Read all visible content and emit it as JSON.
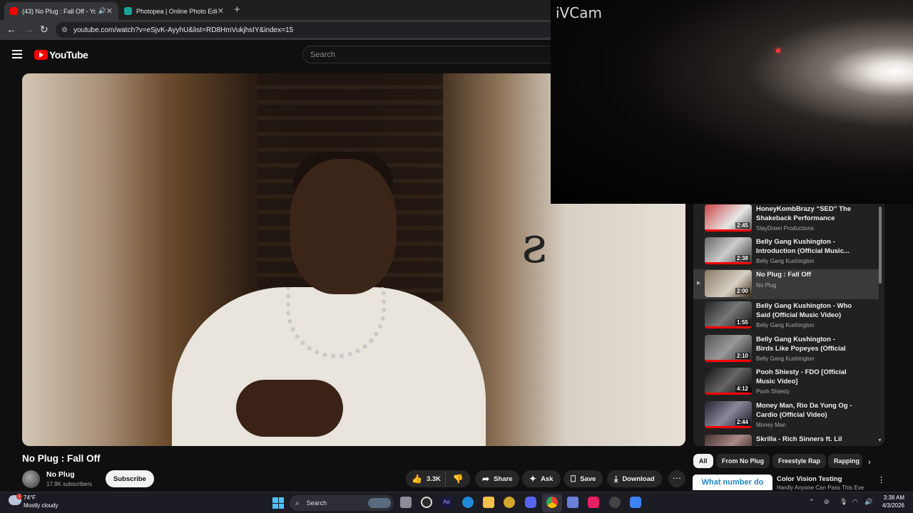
{
  "browser": {
    "tabs": [
      {
        "title": "(43) No Plug : Fall Off - You",
        "color": "#ff0000"
      },
      {
        "title": "Photopea | Online Photo Editor",
        "color": "#18a497"
      }
    ],
    "url": "youtube.com/watch?v=eSjvK-AyyhU&list=RD8HmVukjhsIY&index=15"
  },
  "youtube": {
    "logo_text": "YouTube",
    "search_placeholder": "Search"
  },
  "overlay": {
    "title": "iVCam"
  },
  "video": {
    "title": "No Plug : Fall Off",
    "channel": "No Plug",
    "subscribers": "17.9K subscribers",
    "subscribe_label": "Subscribe",
    "actions": {
      "likes": "3.3K",
      "share": "Share",
      "ask": "Ask",
      "save": "Save",
      "download": "Download"
    }
  },
  "playlist": [
    {
      "title": "HoneyKombBrazy “SED” The Shakeback Performance",
      "channel": "StayDown Productions",
      "duration": "2:45"
    },
    {
      "title": "Belly Gang Kushington - Introduction (Official Music...",
      "channel": "Belly Gang Kushington",
      "duration": "2:38"
    },
    {
      "title": "No Plug : Fall Off",
      "channel": "No Plug",
      "duration": "2:00",
      "current": true
    },
    {
      "title": "Belly Gang Kushington - Who Said (Official Music Video)",
      "channel": "Belly Gang Kushington",
      "duration": "1:55"
    },
    {
      "title": "Belly Gang Kushington - Birds Like Popeyes (Official Music...",
      "channel": "Belly Gang Kushington",
      "duration": "2:10"
    },
    {
      "title": "Pooh Shiesty - FDO [Official Music Video]",
      "channel": "Pooh Shiesty",
      "duration": "4:12"
    },
    {
      "title": "Money Man, Rio Da Yung Og - Cardio (Official Video)",
      "channel": "Money Man",
      "duration": "2:44"
    },
    {
      "title": "Skrilla - Rich Sinners ft. Lil Nu...",
      "channel": "",
      "duration": ""
    }
  ],
  "chips": [
    "All",
    "From No Plug",
    "Freestyle Rap",
    "Rapping"
  ],
  "recommendation": {
    "thumb_text": "What number do",
    "title": "Color Vision Testing",
    "subtitle": "Hardly Anyone Can Pass This Eve"
  },
  "taskbar": {
    "temperature": "74°F",
    "weather": "Mostly cloudy",
    "weather_badge": "1",
    "search_label": "Search",
    "time": "3:38 AM",
    "date": "4/3/2026"
  }
}
